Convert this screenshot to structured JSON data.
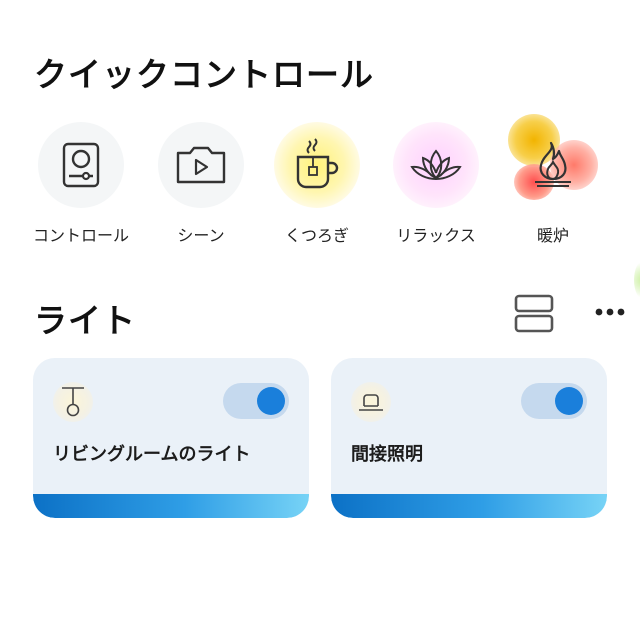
{
  "quick_controls": {
    "title": "クイックコントロール",
    "items": [
      {
        "label": "コントロール",
        "icon": "control-panel-icon"
      },
      {
        "label": "シーン",
        "icon": "scene-camera-icon"
      },
      {
        "label": "くつろぎ",
        "icon": "tea-cup-icon"
      },
      {
        "label": "リラックス",
        "icon": "lotus-icon"
      },
      {
        "label": "暖炉",
        "icon": "fireplace-icon"
      }
    ]
  },
  "lights": {
    "title": "ライト",
    "cards": [
      {
        "name": "リビングルームのライト",
        "icon": "pendant-lamp-icon",
        "on": true
      },
      {
        "name": "間接照明",
        "icon": "indirect-light-icon",
        "on": true
      }
    ]
  },
  "colors": {
    "accent": "#1a7fdb",
    "card_background": "#eaf1f8",
    "toggle_track": "#c5d9ee",
    "bar_start": "#0c71c6",
    "bar_end": "#77d3f6"
  }
}
